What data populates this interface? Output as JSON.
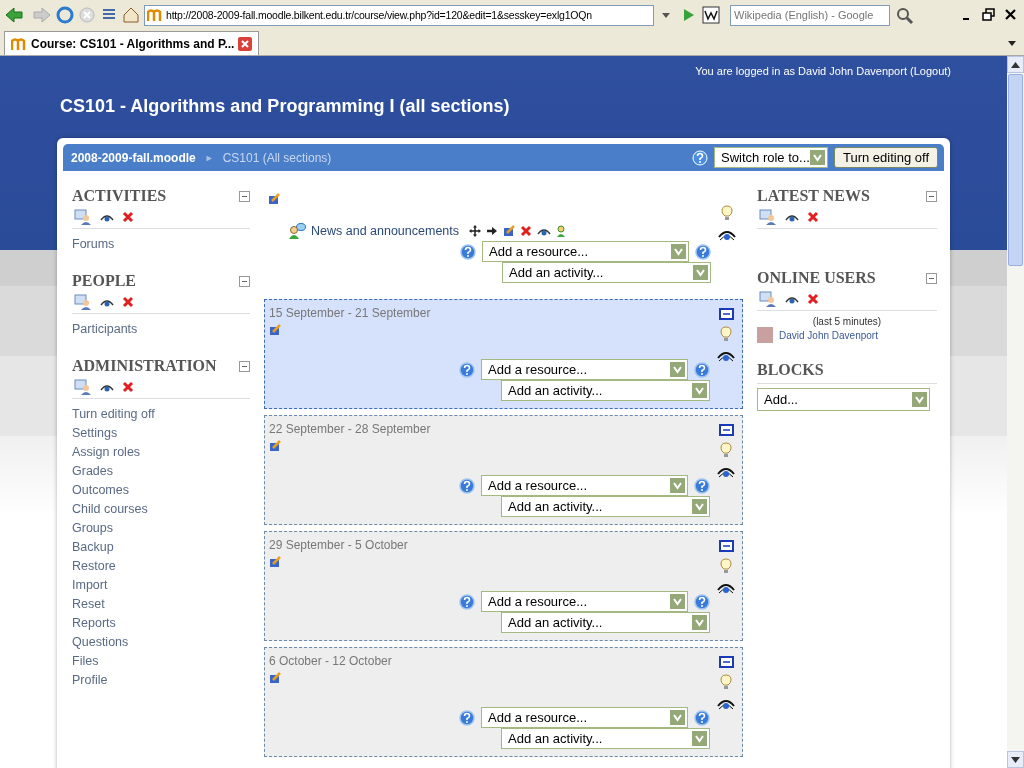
{
  "browser": {
    "url": "http://2008-2009-fall.moodle.bilkent.edu.tr/course/view.php?id=120&edit=1&sesskey=exlg1OQn",
    "search_placeholder": "Wikipedia (English) - Google",
    "tab_title": "Course: CS101 - Algorithms and P..."
  },
  "header": {
    "login_prefix": "You are logged in as",
    "login_user": "David John Davenport",
    "logout": "(Logout)",
    "course_title": "CS101 - Algorithms and Programming I (all sections)"
  },
  "navbar": {
    "home": "2008-2009-fall.moodle",
    "separator": "►",
    "current": "CS101 (All sections)",
    "switch_role": "Switch role to...",
    "edit_button": "Turn editing off"
  },
  "left_blocks": [
    {
      "title": "ACTIVITIES",
      "items": [
        "Forums"
      ]
    },
    {
      "title": "PEOPLE",
      "items": [
        "Participants"
      ]
    },
    {
      "title": "ADMINISTRATION",
      "items": [
        "Turn editing off",
        "Settings",
        "Assign roles",
        "Grades",
        "Outcomes",
        "Child courses",
        "Groups",
        "Backup",
        "Restore",
        "Import",
        "Reset",
        "Reports",
        "Questions",
        "Files",
        "Profile"
      ]
    }
  ],
  "sections": [
    {
      "activities": [
        "News and announcements"
      ],
      "resource": "Add a resource...",
      "activity": "Add an activity..."
    },
    {
      "title": "15 September - 21 September",
      "current": true,
      "resource": "Add a resource...",
      "activity": "Add an activity..."
    },
    {
      "title": "22 September - 28 September",
      "current": false,
      "resource": "Add a resource...",
      "activity": "Add an activity..."
    },
    {
      "title": "29 September - 5 October",
      "current": false,
      "resource": "Add a resource...",
      "activity": "Add an activity..."
    },
    {
      "title": "6 October - 12 October",
      "current": false,
      "resource": "Add a resource...",
      "activity": "Add an activity..."
    }
  ],
  "right_blocks": [
    {
      "kind": "news",
      "title": "LATEST NEWS"
    },
    {
      "kind": "online",
      "title": "ONLINE USERS",
      "note": "(last 5 minutes)",
      "users": [
        "David John Davenport"
      ]
    },
    {
      "kind": "blocks",
      "title": "BLOCKS",
      "select": "Add..."
    }
  ]
}
